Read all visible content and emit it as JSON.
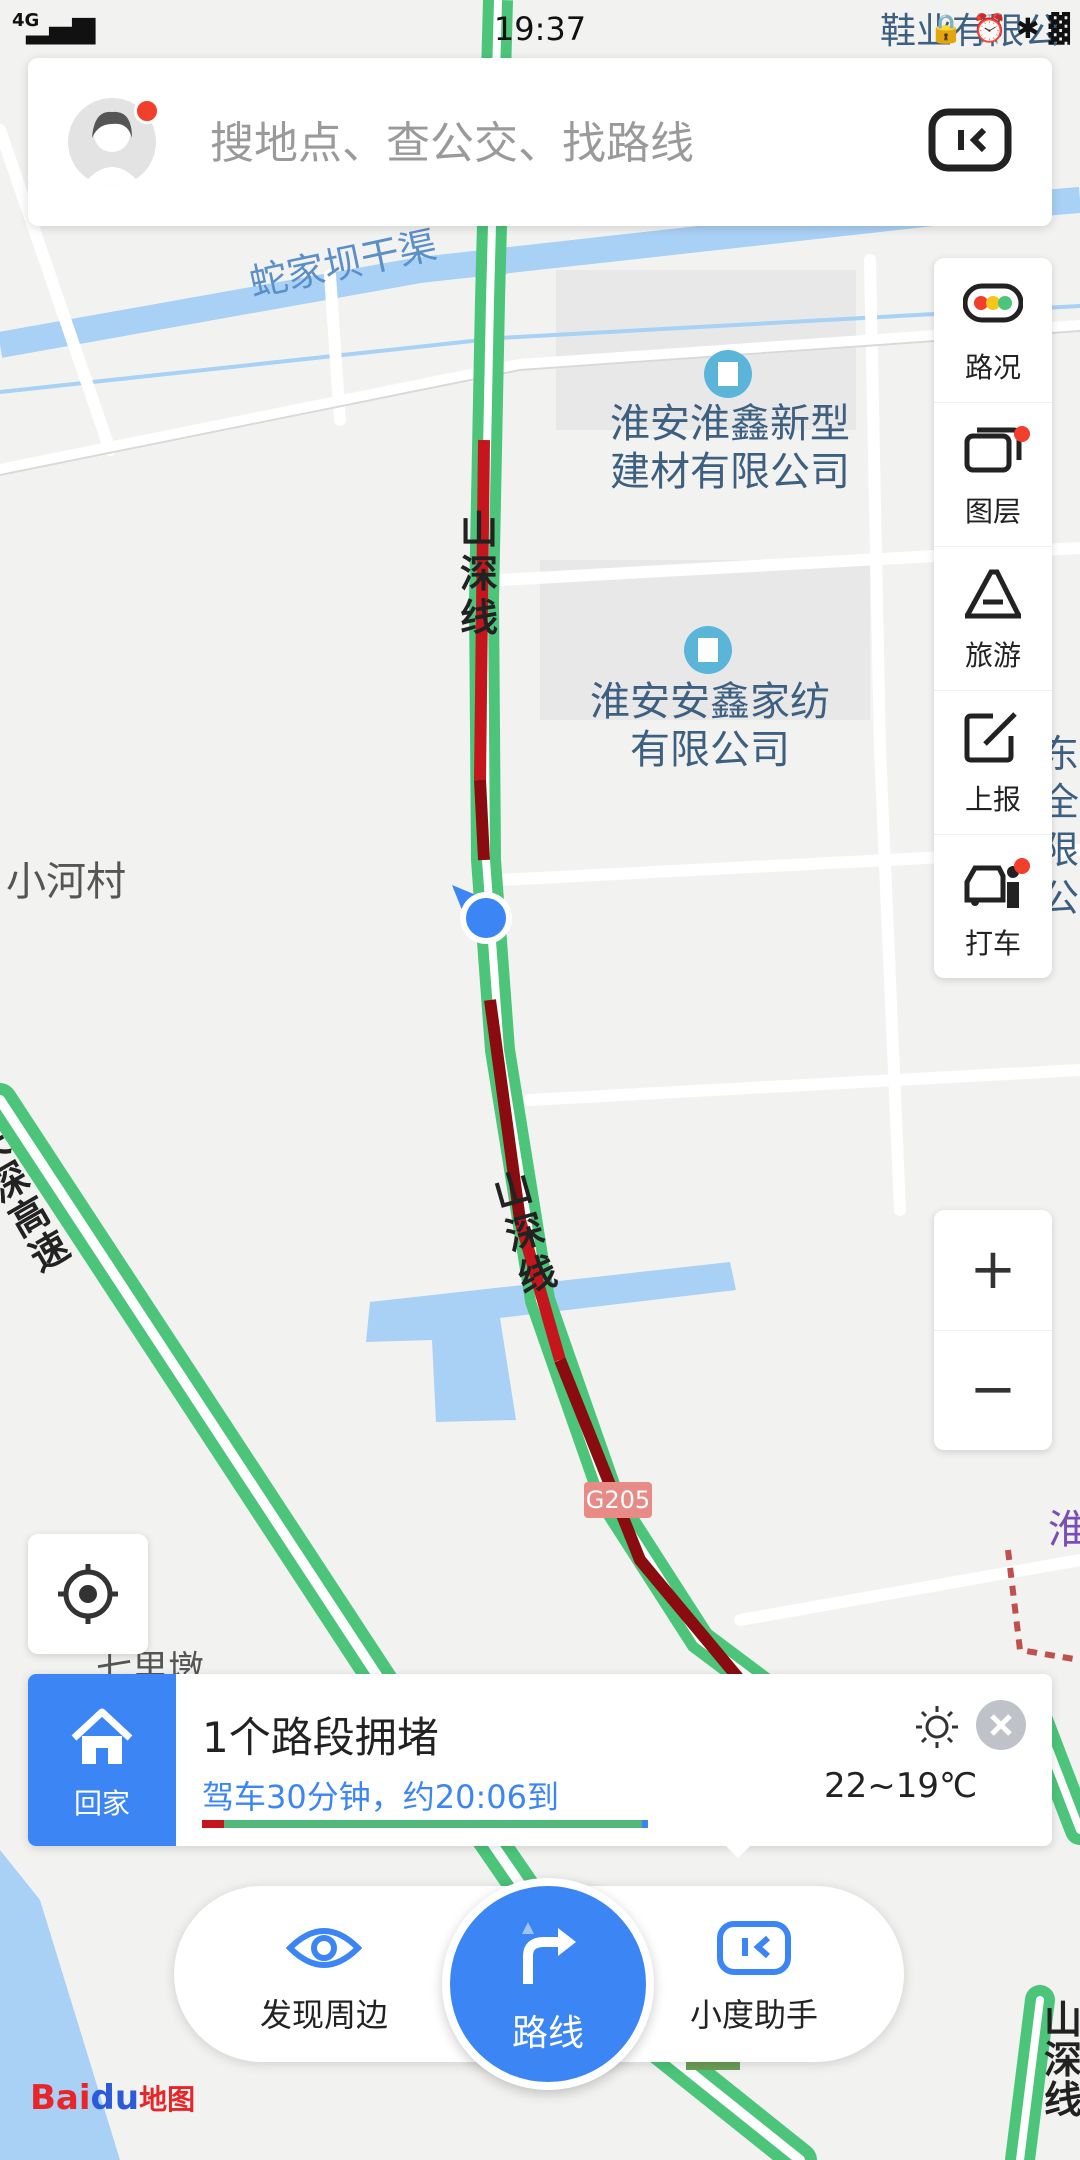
{
  "status_bar": {
    "network": "4G",
    "time": "19:37",
    "right_text": "🔒 ⏰ ✱ ▓"
  },
  "search": {
    "placeholder": "搜地点、查公交、找路线"
  },
  "map": {
    "labels": {
      "canal": "蛇家坝干渠",
      "company1": "淮安淮鑫新型\n建材有限公司",
      "company2": "淮安安鑫家纺\n有限公司",
      "village": "小河村",
      "road1": "山深线",
      "road2": "山深线",
      "expressway": "长深高速",
      "shield": "G205",
      "top_right": "鞋业有限公",
      "right_partial1": "东全\n限公",
      "right_partial2": "淮",
      "bottom_right": "山深线",
      "bottom_left": "七里墩"
    },
    "colors": {
      "smooth": "#4cc57a",
      "congested": "#c4161c",
      "heavy": "#8a0c10",
      "water": "#a9d0f5",
      "accent": "#3b85f5"
    }
  },
  "tools": [
    {
      "label": "路况",
      "icon": "traffic-light-icon",
      "dot": false
    },
    {
      "label": "图层",
      "icon": "layers-icon",
      "dot": true
    },
    {
      "label": "旅游",
      "icon": "travel-icon",
      "dot": false
    },
    {
      "label": "上报",
      "icon": "report-icon",
      "dot": false
    },
    {
      "label": "打车",
      "icon": "taxi-icon",
      "dot": true
    }
  ],
  "zoom": {
    "in": "+",
    "out": "−"
  },
  "home_card": {
    "home_label": "回家",
    "title": "1个路段拥堵",
    "subtitle": "驾车30分钟，约20:06到",
    "temperature": "22~19℃",
    "weather_icon": "sun-icon"
  },
  "bottom_nav": {
    "discover": "发现周边",
    "route": "路线",
    "assistant": "小度助手"
  },
  "logo": {
    "text": "Baidu地图"
  }
}
